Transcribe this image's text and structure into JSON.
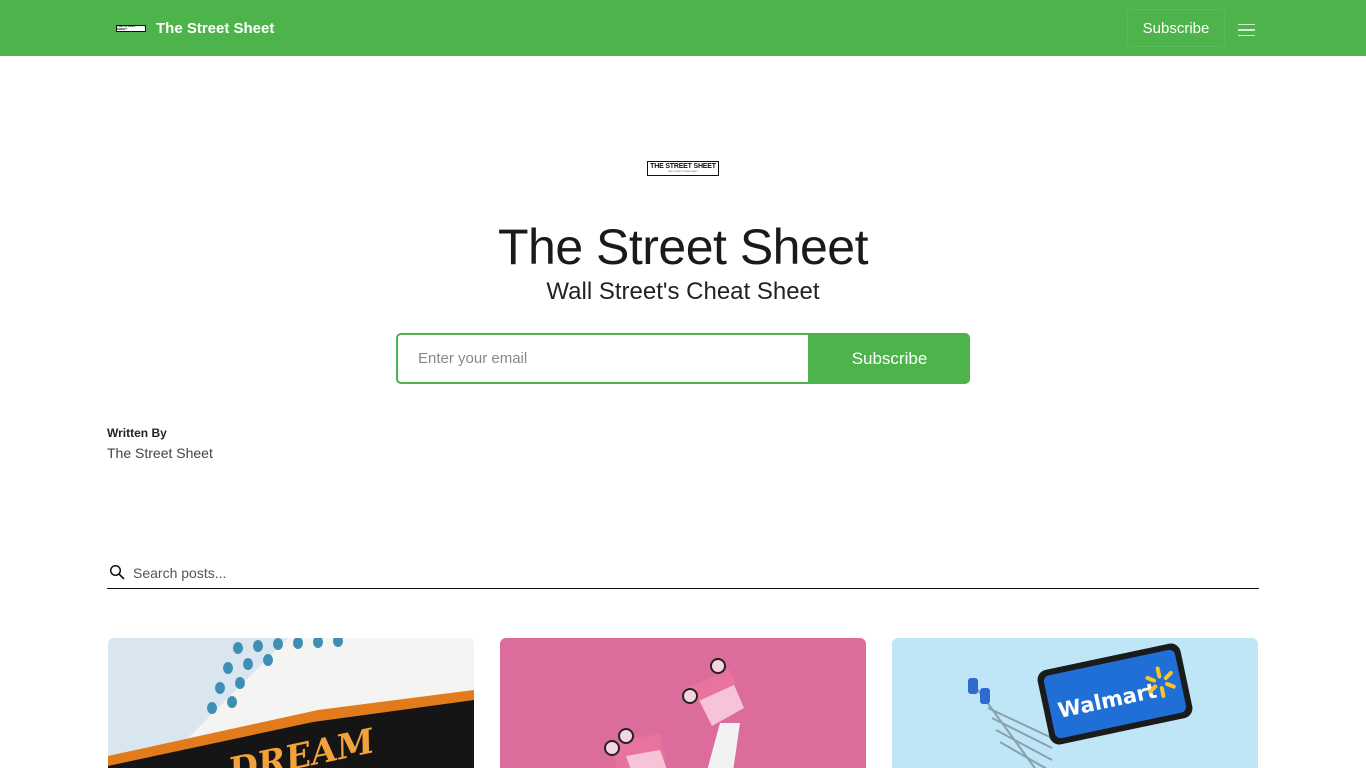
{
  "nav": {
    "brand_logo_text": "THE STREET SHEET",
    "brand_name": "The Street Sheet",
    "subscribe_label": "Subscribe",
    "menu_icon": "hamburger-icon"
  },
  "hero": {
    "logo_line1": "THE STREET SHEET",
    "logo_line2": "WALL STREET'S CHEAT SHEET",
    "title": "The Street Sheet",
    "subtitle": "Wall Street's Cheat Sheet",
    "email_placeholder": "Enter your email",
    "subscribe_label": "Subscribe"
  },
  "author": {
    "label": "Written By",
    "name": "The Street Sheet"
  },
  "search": {
    "placeholder": "Search posts...",
    "icon": "search-icon"
  },
  "cards": [
    {
      "image": "cruise-ship-thumbnail",
      "image_text": "DREAM"
    },
    {
      "image": "roller-skates-thumbnail"
    },
    {
      "image": "walmart-cart-thumbnail",
      "image_text": "Walmart"
    }
  ],
  "colors": {
    "accent": "#4cb44a",
    "text": "#1a1a1a"
  }
}
